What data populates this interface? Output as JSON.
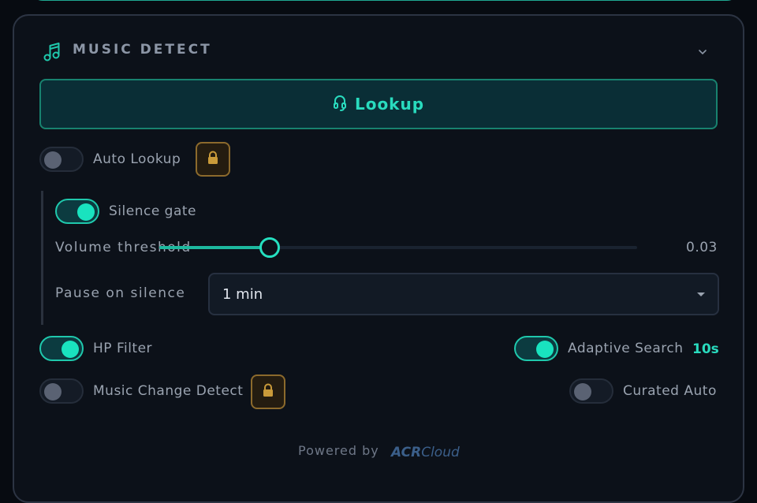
{
  "panel": {
    "title": "MUSIC DETECT",
    "icon": "music-note-icon",
    "collapse_icon": "chevron-down-icon"
  },
  "lookup": {
    "label": "Lookup",
    "icon": "headphones-icon"
  },
  "auto_lookup": {
    "label": "Auto Lookup",
    "enabled": false,
    "locked": true,
    "lock_icon": "lock-icon"
  },
  "silence_gate": {
    "label": "Silence gate",
    "enabled": true,
    "volume_threshold": {
      "label": "Volume threshold",
      "value": "0.03",
      "fill_fraction": 0.23
    },
    "pause_on_silence": {
      "label": "Pause on silence",
      "selected": "1 min"
    }
  },
  "hp_filter": {
    "label": "HP Filter",
    "enabled": true
  },
  "adaptive_search": {
    "label": "Adaptive Search",
    "enabled": true,
    "value": "10s"
  },
  "music_change_detect": {
    "label": "Music Change Detect",
    "enabled": false,
    "locked": true
  },
  "curated_auto": {
    "label": "Curated Auto",
    "enabled": false
  },
  "footer": {
    "powered_by": "Powered by",
    "brand_bold": "ACR",
    "brand_light": "Cloud"
  },
  "colors": {
    "accent": "#19e3bf",
    "lock": "#c99a3a",
    "panel_bg": "#0c1119"
  }
}
